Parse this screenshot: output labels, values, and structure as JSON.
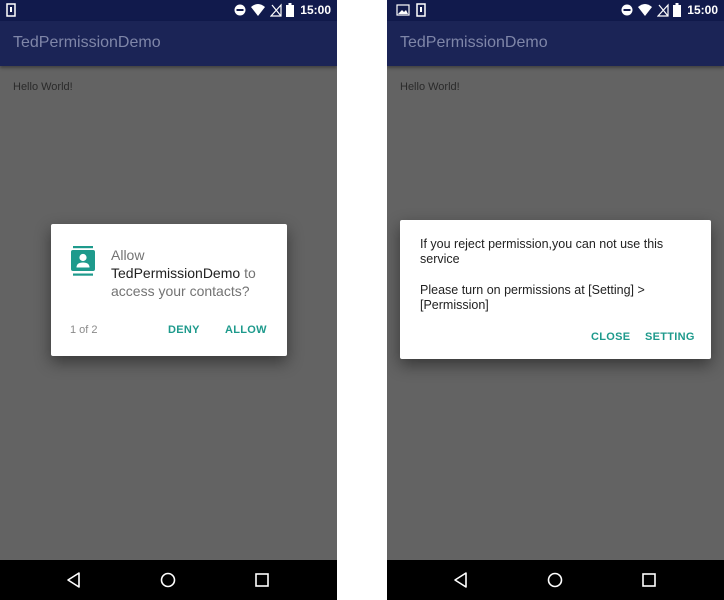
{
  "statusbar": {
    "time": "15:00"
  },
  "app": {
    "title": "TedPermissionDemo",
    "hello_text": "Hello World!"
  },
  "permission_dialog": {
    "prefix": "Allow",
    "app_name": "TedPermissionDemo",
    "suffix": "to access your contacts?",
    "counter": "1 of 2",
    "deny_label": "DENY",
    "allow_label": "ALLOW"
  },
  "denied_dialog": {
    "message": "If you reject permission,you can not use this service",
    "instruction": "Please turn on permissions at [Setting] > [Permission]",
    "close_label": "CLOSE",
    "setting_label": "SETTING"
  },
  "colors": {
    "status_bar": "#111a4c",
    "app_bar": "#1b2456",
    "accent": "#1e9a8c",
    "scrim": "#636363"
  },
  "icons": [
    "sim-icon",
    "image-icon",
    "do-not-disturb-icon",
    "wifi-icon",
    "no-signal-icon",
    "battery-icon",
    "contacts-icon",
    "back-icon",
    "home-icon",
    "recents-icon"
  ]
}
